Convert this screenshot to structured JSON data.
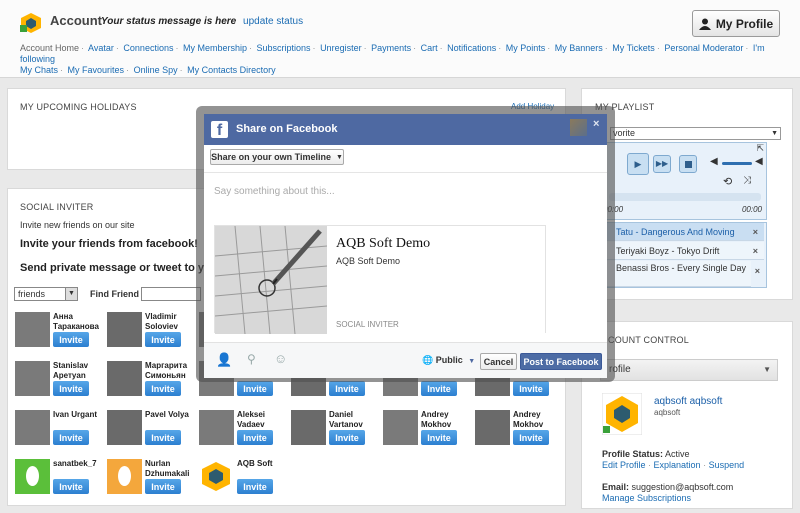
{
  "header": {
    "title": "Account",
    "status_message": "Your status message is here",
    "update_status": "update status",
    "my_profile": "My Profile",
    "nav": [
      "Account Home",
      "Avatar",
      "Connections",
      "My Membership",
      "Subscriptions",
      "Unregister",
      "Payments",
      "Cart",
      "Notifications",
      "My Points",
      "My Banners",
      "My Tickets",
      "Personal Moderator",
      "I'm following",
      "My Chats",
      "My Favourites",
      "Online Spy",
      "My Contacts Directory"
    ]
  },
  "holidays": {
    "title": "MY UPCOMING HOLIDAYS",
    "add": "Add Holiday"
  },
  "inviter": {
    "title": "SOCIAL INVITER",
    "intro": "Invite new friends on our site",
    "facebook_line": "Invite your friends from facebook!",
    "private_line": "Send private message or tweet to yo",
    "select_value": "friends",
    "find_label": "Find Friend :",
    "invite": "Invite",
    "people": [
      {
        "name": "Анна Тараканова"
      },
      {
        "name": "Vladimir Soloviev"
      },
      {
        "name": ""
      },
      {
        "name": ""
      },
      {
        "name": ""
      },
      {
        "name": ""
      },
      {
        "name": "Stanislav Аретyan"
      },
      {
        "name": "Маргарита Симоньян"
      },
      {
        "name": ""
      },
      {
        "name": ""
      },
      {
        "name": ""
      },
      {
        "name": ""
      },
      {
        "name": "Ivan Urgant"
      },
      {
        "name": "Pavel Volya"
      },
      {
        "name": "Aleksei Vadaev"
      },
      {
        "name": "Daniel Vartanov"
      },
      {
        "name": "Andrey Mokhov"
      },
      {
        "name": "Andrey Mokhov"
      },
      {
        "name": "sanatbek_7"
      },
      {
        "name": "Nurlan Dzhumakali"
      },
      {
        "name": "AQB Soft"
      }
    ]
  },
  "playlist": {
    "title": "MY PLAYLIST",
    "select_value": "vorite",
    "time_start": "00:00",
    "time_end": "00:00",
    "tracks": [
      "Tatu - Dangerous And Moving",
      "Teriyaki Boyz - Tokyo Drift",
      "Benassi Bros - Every Single Day"
    ]
  },
  "account_control": {
    "title": "COUNT CONTROL",
    "profile_tab": "rofile",
    "name": "aqbsoft aqbsoft",
    "username": "aqbsoft",
    "status_label": "Profile Status:",
    "status_value": "Active",
    "links": [
      "Edit Profile",
      "Explanation",
      "Suspend"
    ],
    "email_label": "Email:",
    "email": "suggestion@aqbsoft.com",
    "manage": "Manage Subscriptions"
  },
  "facebook": {
    "title": "Share on Facebook",
    "audience": "Share on your own Timeline",
    "placeholder": "Say something about this...",
    "card_title": "AQB Soft Demo",
    "card_sub": "AQB Soft Demo",
    "card_source": "SOCIAL INVITER",
    "privacy": "Public",
    "cancel": "Cancel",
    "post": "Post to Facebook",
    "brand": "#3b5998"
  }
}
